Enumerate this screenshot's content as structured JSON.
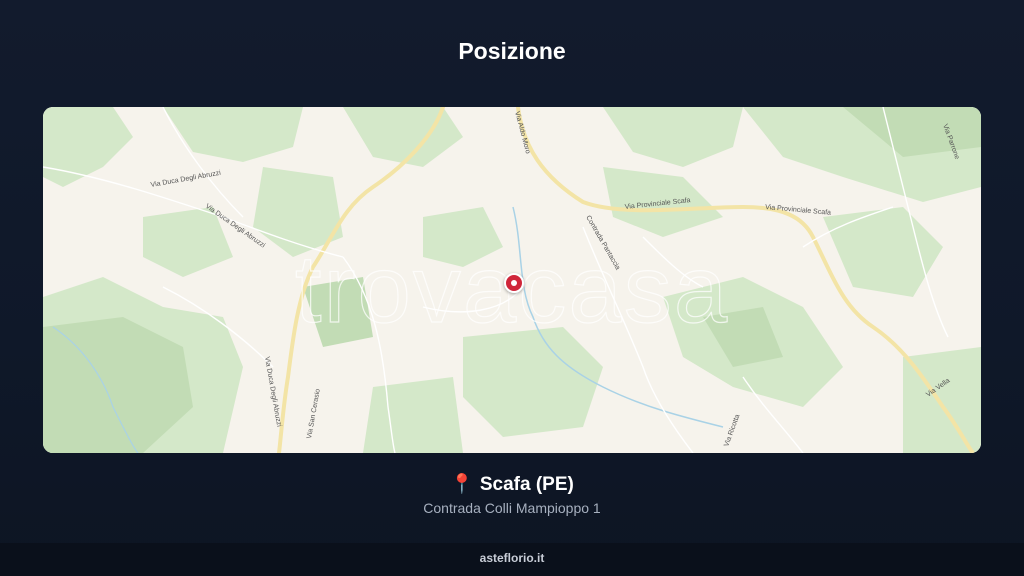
{
  "header": {
    "title": "Posizione"
  },
  "map": {
    "watermark": "trovacasa",
    "roads": [
      "Via Duca Degli Abruzzi",
      "Via Duca Degli Abruzzi",
      "Via Provinciale Scafa",
      "Via Provinciale Scafa",
      "Via San Cerasio",
      "Via Duca Degli Abruzzi",
      "Contrada Pantaccia",
      "Via Aldo Moro",
      "Via Vella",
      "Via Parrone",
      "Via Ricotta"
    ],
    "marker_icon": "map-marker-icon"
  },
  "location": {
    "pin_icon": "📍",
    "name": "Scafa (PE)",
    "address": "Contrada Colli Mampioppo 1"
  },
  "footer": {
    "site": "asteflorio.it"
  }
}
